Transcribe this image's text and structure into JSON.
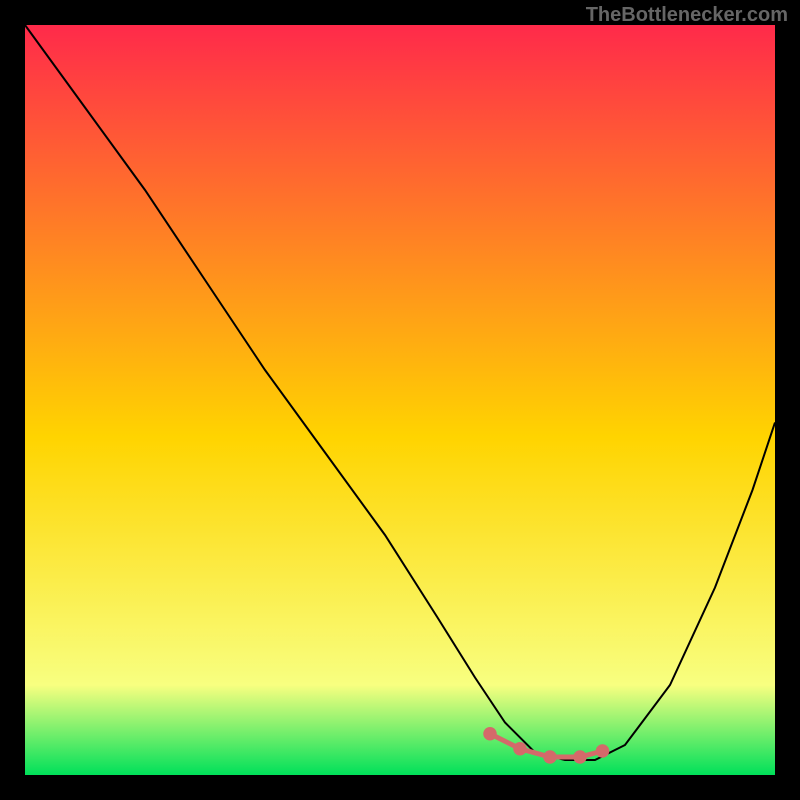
{
  "watermark": "TheBottlenecker.com",
  "chart_data": {
    "type": "line",
    "title": "",
    "xlabel": "",
    "ylabel": "",
    "xlim": [
      0,
      100
    ],
    "ylim": [
      0,
      100
    ],
    "grid": false,
    "background_gradient": {
      "top": "#ff2a4a",
      "mid": "#ffd400",
      "low": "#f8ff80",
      "bottom": "#00e05a"
    },
    "series": [
      {
        "name": "bottleneck-curve",
        "color": "#000000",
        "x": [
          0,
          8,
          16,
          24,
          32,
          40,
          48,
          55,
          60,
          64,
          68,
          72,
          76,
          80,
          86,
          92,
          97,
          100
        ],
        "y": [
          100,
          89,
          78,
          66,
          54,
          43,
          32,
          21,
          13,
          7,
          3,
          2,
          2,
          4,
          12,
          25,
          38,
          47
        ]
      }
    ],
    "highlight": {
      "name": "optimal-range",
      "color": "#d46a6a",
      "points_x": [
        62,
        66,
        70,
        74,
        77
      ],
      "points_y": [
        5.5,
        3.5,
        2.4,
        2.4,
        3.2
      ]
    }
  }
}
